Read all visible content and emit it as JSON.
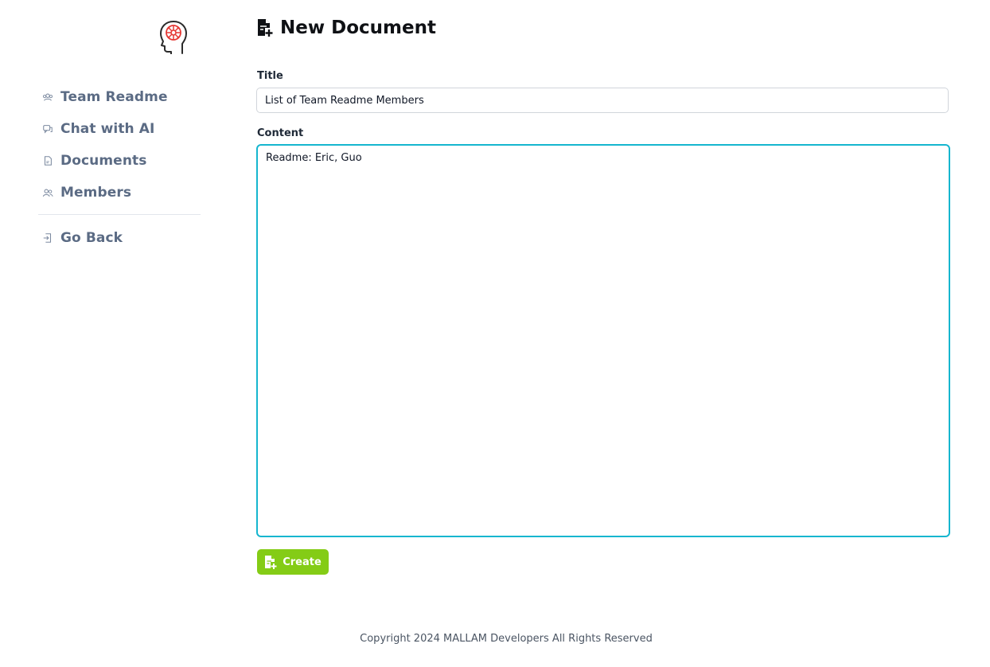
{
  "sidebar": {
    "logo_icon": "ai-head-circuit-icon",
    "items": [
      {
        "label": "Team Readme",
        "icon": "team-icon"
      },
      {
        "label": "Chat with AI",
        "icon": "chat-icon"
      },
      {
        "label": "Documents",
        "icon": "document-icon"
      },
      {
        "label": "Members",
        "icon": "members-icon"
      }
    ],
    "back": {
      "label": "Go Back",
      "icon": "exit-icon"
    }
  },
  "main": {
    "title": "New Document",
    "title_icon": "file-plus-icon",
    "title_field": {
      "label": "Title",
      "value": "List of Team Readme Members"
    },
    "content_field": {
      "label": "Content",
      "value": "Readme: Eric, Guo"
    },
    "create_button": {
      "label": "Create",
      "icon": "file-plus-icon"
    }
  },
  "footer": {
    "text": "Copyright 2024 MALLAM Developers All Rights Reserved"
  },
  "colors": {
    "sidebar_text": "#5b6b84",
    "focus_border": "#16b6cf",
    "create_button": "#84cc16",
    "logo_accent": "#e53935"
  }
}
